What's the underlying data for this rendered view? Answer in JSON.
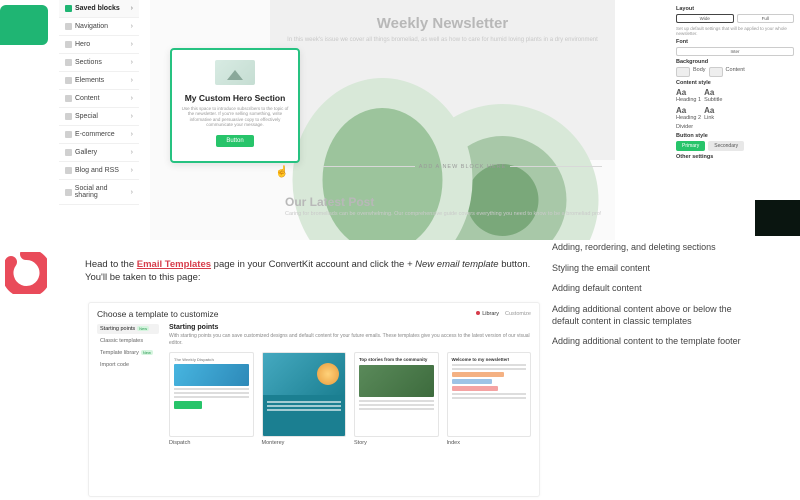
{
  "editor": {
    "sidebar": {
      "items": [
        {
          "label": "Saved blocks",
          "icon": "saved-icon"
        },
        {
          "label": "Navigation",
          "icon": "nav-icon"
        },
        {
          "label": "Hero",
          "icon": "hero-icon"
        },
        {
          "label": "Sections",
          "icon": "sections-icon"
        },
        {
          "label": "Elements",
          "icon": "elements-icon"
        },
        {
          "label": "Content",
          "icon": "content-icon"
        },
        {
          "label": "Special",
          "icon": "special-icon"
        },
        {
          "label": "E-commerce",
          "icon": "ecommerce-icon"
        },
        {
          "label": "Gallery",
          "icon": "gallery-icon"
        },
        {
          "label": "Blog and RSS",
          "icon": "blog-icon"
        },
        {
          "label": "Social and sharing",
          "icon": "social-icon"
        }
      ]
    },
    "hero_card": {
      "title": "My Custom Hero Section",
      "subtitle": "Use this space to introduce subscribers to the topic of the newsletter. If you're selling something, write informative and persuasive copy to effectively communicate your message.",
      "button": "Button"
    },
    "newsletter": {
      "title": "Weekly Newsletter",
      "subtitle": "In this week's issue we cover all things bromeliad, as well as how to care for humid loving plants in a dry environment"
    },
    "add_block": "ADD A NEW BLOCK HERE",
    "latest_post": {
      "title": "Our Latest Post",
      "subtitle": "Caring for bromeliads can be overwhelming. Our comprehensive guide covers everything you need to know to be a bromeliad pro!"
    },
    "properties": {
      "layout_label": "Layout",
      "layout_opts": {
        "a": "Wide",
        "b": "Full"
      },
      "layout_desc": "Set up default settings that will be applied to your whole newsletter.",
      "font_label": "Font",
      "font_value": "Inter",
      "background_label": "Background",
      "bg_opts": {
        "a": "Body",
        "b": "Content"
      },
      "content_style_label": "Content style",
      "heading1": "Heading 1",
      "heading2": "Heading 2",
      "subtitle": "Subtitle",
      "link": "Link",
      "divider": "Divider",
      "button_style_label": "Button style",
      "btn_primary": "Primary",
      "btn_secondary": "Secondary",
      "other_label": "Other settings"
    }
  },
  "article": {
    "paragraph_pre": "Head to the ",
    "link_text": "Email Templates",
    "paragraph_mid": " page in your ConvertKit account and click the ",
    "btn_name": "+ New email template",
    "paragraph_post": " button. You'll be taken to this page:"
  },
  "toc": {
    "items": [
      "Adding, reordering, and deleting sections",
      "Styling the email content",
      "Adding default content",
      "Adding additional content above or below the default content in classic templates",
      "Adding additional content to the template footer"
    ]
  },
  "template_selector": {
    "title": "Choose a template to customize",
    "tabs": {
      "library": "Library",
      "customize": "Customize"
    },
    "categories": [
      {
        "label": "Starting points",
        "new": true
      },
      {
        "label": "Classic templates"
      },
      {
        "label": "Template library",
        "new": true
      },
      {
        "label": "Import code"
      }
    ],
    "section_title": "Starting points",
    "section_desc": "With starting points you can save customized designs and default content for your future emails. These templates give you access to the latest version of our visual editor.",
    "templates": [
      {
        "name": "Dispatch"
      },
      {
        "name": "Monterey"
      },
      {
        "name": "Story"
      },
      {
        "name": "Index"
      }
    ]
  }
}
